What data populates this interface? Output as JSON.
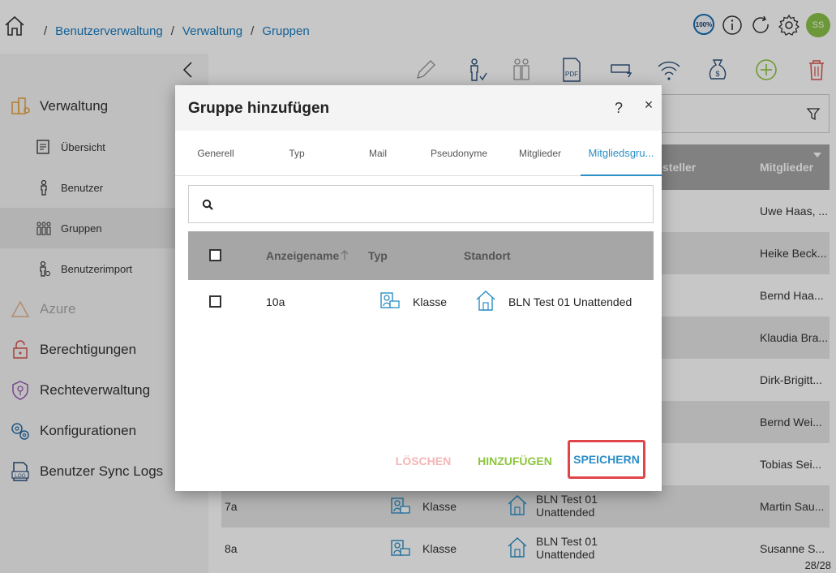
{
  "breadcrumb": {
    "items": [
      "Benutzerverwaltung",
      "Verwaltung",
      "Gruppen"
    ],
    "separator": "/"
  },
  "top_bar": {
    "zoom": "100%",
    "avatar": "SS",
    "icons": [
      "zoom-icon",
      "info-icon",
      "refresh-icon",
      "gear-icon",
      "avatar"
    ]
  },
  "sidebar": {
    "items": [
      {
        "label": "Verwaltung",
        "level": "main",
        "icon": "admin-icon"
      },
      {
        "label": "Übersicht",
        "level": "sub",
        "icon": "overview-icon"
      },
      {
        "label": "Benutzer",
        "level": "sub",
        "icon": "user-icon"
      },
      {
        "label": "Gruppen",
        "level": "sub",
        "icon": "group-icon",
        "active": true
      },
      {
        "label": "Benutzerimport",
        "level": "sub",
        "icon": "user-import-icon"
      },
      {
        "label": "Azure",
        "level": "main",
        "icon": "azure-icon",
        "disabled": true
      },
      {
        "label": "Berechtigungen",
        "level": "main",
        "icon": "lock-icon"
      },
      {
        "label": "Rechteverwaltung",
        "level": "main",
        "icon": "shield-key-icon"
      },
      {
        "label": "Konfigurationen",
        "level": "main",
        "icon": "gears-icon"
      },
      {
        "label": "Benutzer Sync Logs",
        "level": "main",
        "icon": "log-icon"
      }
    ]
  },
  "background_table": {
    "headers": [
      "steller",
      "Mitglieder"
    ],
    "rows": [
      {
        "name": "",
        "typ": "",
        "standort": "",
        "mitglieder": "Uwe Haas, ..."
      },
      {
        "name": "",
        "typ": "",
        "standort": "",
        "mitglieder": "Heike Beck..."
      },
      {
        "name": "",
        "typ": "",
        "standort": "",
        "mitglieder": "Bernd Haa..."
      },
      {
        "name": "",
        "typ": "",
        "standort": "",
        "mitglieder": "Klaudia Bra..."
      },
      {
        "name": "",
        "typ": "",
        "standort": "",
        "mitglieder": "Dirk-Brigitt..."
      },
      {
        "name": "",
        "typ": "",
        "standort": "",
        "mitglieder": "Bernd Wei..."
      },
      {
        "name": "",
        "typ": "",
        "standort": "",
        "mitglieder": "Tobias Sei..."
      },
      {
        "name": "7a",
        "typ": "Klasse",
        "standort": "BLN Test 01 Unattended",
        "mitglieder": "Martin Sau..."
      },
      {
        "name": "8a",
        "typ": "Klasse",
        "standort": "BLN Test 01 Unattended",
        "mitglieder": "Susanne S..."
      }
    ],
    "pager": "28/28"
  },
  "modal": {
    "title": "Gruppe hinzufügen",
    "help": "?",
    "close": "×",
    "tabs": [
      "Generell",
      "Typ",
      "Mail",
      "Pseudonyme",
      "Mitglieder",
      "Mitgliedsgru..."
    ],
    "active_tab": 5,
    "search": {
      "value": "",
      "placeholder": ""
    },
    "table": {
      "headers": [
        "Anzeigename",
        "Typ",
        "Standort"
      ],
      "sort": "asc",
      "rows": [
        {
          "name": "10a",
          "typ": "Klasse",
          "standort": "BLN Test 01 Unattended"
        }
      ]
    },
    "buttons": {
      "delete": "LÖSCHEN",
      "add": "HINZUFÜGEN",
      "save": "SPEICHERN"
    }
  },
  "colors": {
    "accent": "#2b8ec6",
    "link": "#1a7cc0",
    "green": "#8dc63f",
    "delete_disabled": "#f4b5b5",
    "highlight": "#e0454a",
    "table_header": "#a6a6a6"
  }
}
